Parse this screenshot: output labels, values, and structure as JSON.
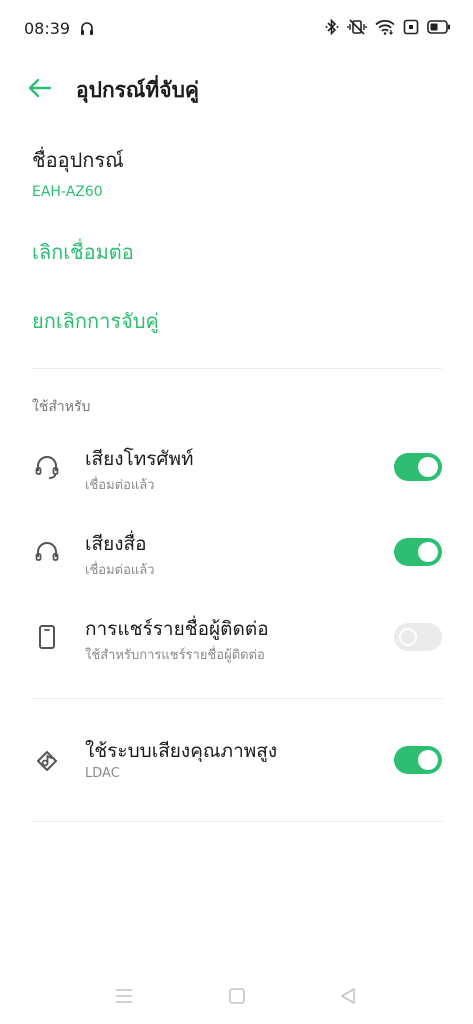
{
  "status_bar": {
    "time": "08:39"
  },
  "header": {
    "title": "อุปกรณ์ที่จับคู่"
  },
  "device": {
    "name_label": "ชื่ออุปกรณ์",
    "name_value": "EAH-AZ60"
  },
  "actions": {
    "disconnect": "เลิกเชื่อมต่อ",
    "unpair": "ยกเลิกการจับคู่"
  },
  "use_for": {
    "header": "ใช้สำหรับ",
    "items": [
      {
        "title": "เสียงโทรศัพท์",
        "subtitle": "เชื่อมต่อแล้ว",
        "icon": "headset-icon",
        "enabled": true
      },
      {
        "title": "เสียงสื่อ",
        "subtitle": "เชื่อมต่อแล้ว",
        "icon": "headphones-icon",
        "enabled": true
      },
      {
        "title": "การแชร์รายชื่อผู้ติดต่อ",
        "subtitle": "ใช้สำหรับการแชร์รายชื่อผู้ติดต่อ",
        "icon": "phone-icon",
        "enabled": false,
        "disabled": true
      }
    ]
  },
  "hd_audio": {
    "title": "ใช้ระบบเสียงคุณภาพสูง",
    "subtitle": "LDAC",
    "icon": "hd-audio-icon",
    "enabled": true
  },
  "colors": {
    "accent": "#2dbe72",
    "toggle_disabled": "#ebebeb"
  }
}
